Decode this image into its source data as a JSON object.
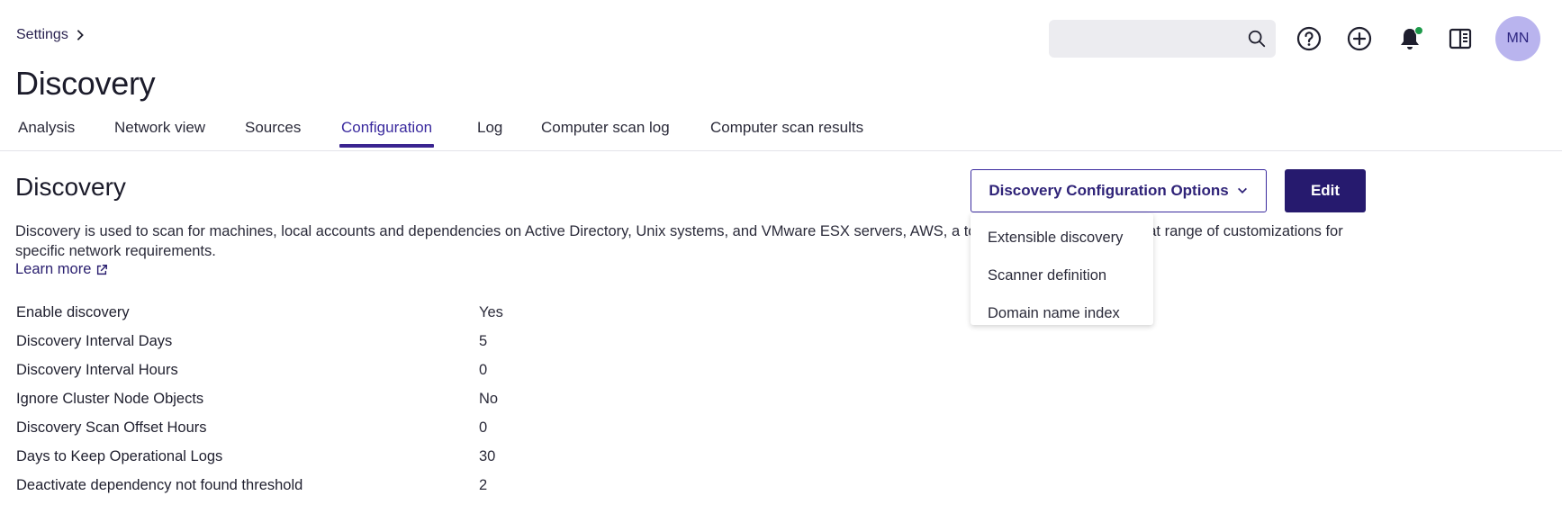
{
  "breadcrumb": {
    "parent": "Settings"
  },
  "page_title": "Discovery",
  "header": {
    "search_placeholder": "",
    "avatar_initials": "MN",
    "colors": {
      "notification_dot": "#1d9a4a",
      "avatar_bg": "#b9b4ee"
    }
  },
  "tabs": [
    {
      "label": "Analysis"
    },
    {
      "label": "Network view"
    },
    {
      "label": "Sources"
    },
    {
      "label": "Configuration",
      "active": true
    },
    {
      "label": "Log"
    },
    {
      "label": "Computer scan log"
    },
    {
      "label": "Computer scan results"
    }
  ],
  "section": {
    "title": "Discovery",
    "options_button": "Discovery Configuration Options",
    "edit_button": "Edit",
    "description": "Discovery is used to scan for machines, local accounts and dependencies on Active Directory, Unix systems, and VMware ESX servers, AWS, a to set up and provides a great range of customizations for specific network requirements.",
    "learn_more": "Learn more"
  },
  "properties": [
    {
      "label": "Enable discovery",
      "value": "Yes"
    },
    {
      "label": "Discovery Interval Days",
      "value": "5"
    },
    {
      "label": "Discovery Interval Hours",
      "value": "0"
    },
    {
      "label": "Ignore Cluster Node Objects",
      "value": "No"
    },
    {
      "label": "Discovery Scan Offset Hours",
      "value": "0"
    },
    {
      "label": "Days to Keep Operational Logs",
      "value": "30"
    },
    {
      "label": "Deactivate dependency not found threshold",
      "value": "2"
    }
  ],
  "dropdown": {
    "items": [
      "Extensible discovery",
      "Scanner definition",
      "Domain name index"
    ]
  },
  "colors": {
    "accent": "#3a2a9e",
    "primary_button": "#261a6e"
  }
}
